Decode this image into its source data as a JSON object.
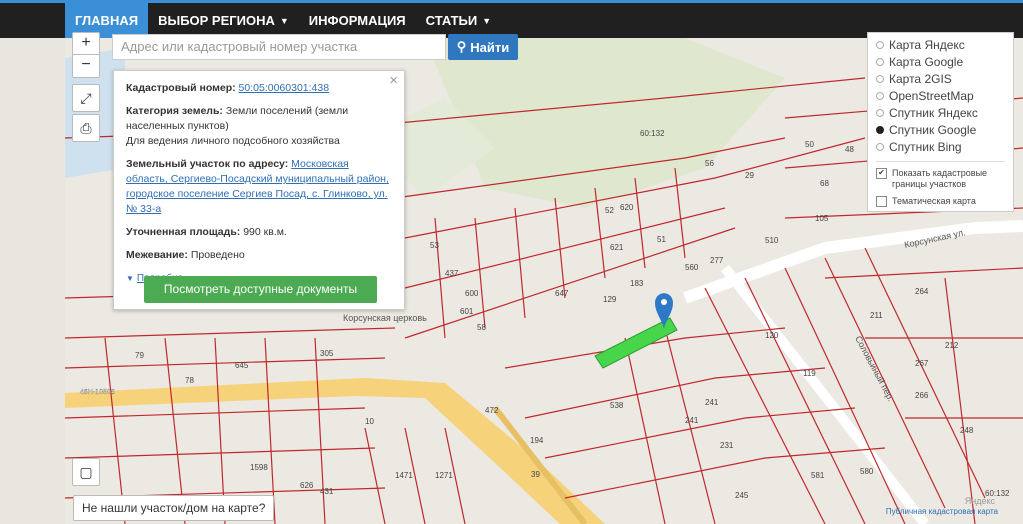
{
  "nav": {
    "items": [
      {
        "label": "ГЛАВНАЯ"
      },
      {
        "label": "ВЫБОР РЕГИОНА"
      },
      {
        "label": "ИНФОРМАЦИЯ"
      },
      {
        "label": "СТАТЬИ"
      }
    ]
  },
  "search": {
    "placeholder": "Адрес или кадастровый номер участка",
    "button": "Найти"
  },
  "popup": {
    "cadastral_label": "Кадастровый номер:",
    "cadastral_value": "50:05:0060301:438",
    "category_label": "Категория земель:",
    "category_value": "Земли поселений (земли населенных пунктов)",
    "usage": "Для ведения личного подсобного хозяйства",
    "address_label": "Земельный участок по адресу:",
    "address_value": "Московская область, Сергиево-Посадский муниципальный район, городское поселение Сергиев Посад, с. Глинково, ул. № 33-а",
    "area_label": "Уточненная площадь:",
    "area_value": "990 кв.м.",
    "survey_label": "Межевание:",
    "survey_value": "Проведено",
    "more": "Подробно",
    "docs_button": "Посмотреть доступные документы"
  },
  "layers": {
    "options": [
      {
        "label": "Карта Яндекс",
        "selected": false
      },
      {
        "label": "Карта Google",
        "selected": false
      },
      {
        "label": "Карта 2GIS",
        "selected": false
      },
      {
        "label": "OpenStreetMap",
        "selected": false
      },
      {
        "label": "Спутник Яндекс",
        "selected": false
      },
      {
        "label": "Спутник Google",
        "selected": true
      },
      {
        "label": "Спутник Bing",
        "selected": false
      }
    ],
    "show_cadastral": "Показать кадастровые границы участков",
    "thematic": "Тематическая карта"
  },
  "map": {
    "not_found": "Не нашли участок/дом на карте?",
    "footer": "Публичная кадастровая карта",
    "brand": "Яндекс",
    "labels": {
      "church": "Корсунская церковь",
      "street1": "Корсунская ул.",
      "street2": "Соловьиный пер.",
      "road": "46Н-10508",
      "cad_block": "60:132",
      "cad_block2": "60:132"
    }
  },
  "colors": {
    "accent": "#3a8fd6",
    "parcel": "#c0282d",
    "highlight": "#47d64a",
    "button_green": "#4caa52"
  }
}
